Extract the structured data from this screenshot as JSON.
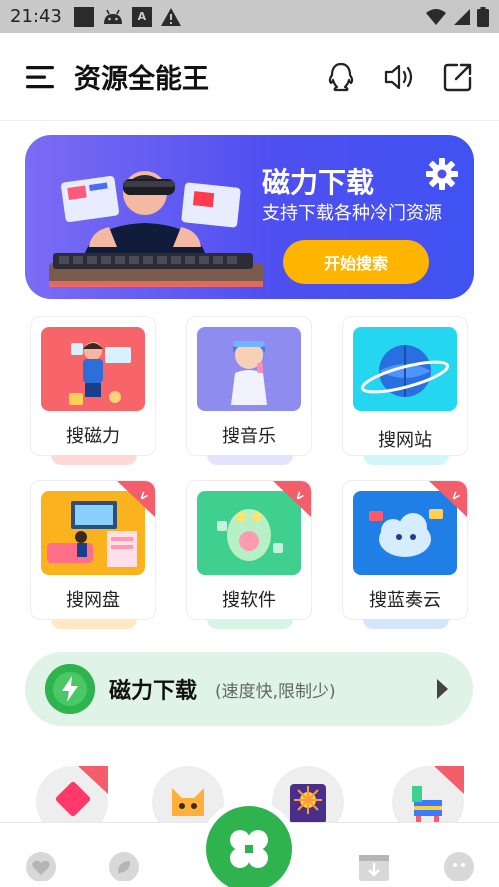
{
  "status_bar": {
    "time": "21:43"
  },
  "header": {
    "title": "资源全能王"
  },
  "banner": {
    "title": "磁力下载",
    "subtitle": "支持下载各种冷门资源",
    "button_label": "开始搜索"
  },
  "grid": [
    {
      "label": "搜磁力",
      "vip": false,
      "color": "#f7656a"
    },
    {
      "label": "搜音乐",
      "vip": false,
      "color": "#8f8cf0"
    },
    {
      "label": "搜网站",
      "vip": false,
      "color": "#25d6f0"
    },
    {
      "label": "搜网盘",
      "vip": true,
      "color": "#fbb21f"
    },
    {
      "label": "搜软件",
      "vip": true,
      "color": "#3fcf8e"
    },
    {
      "label": "搜蓝奏云",
      "vip": true,
      "color": "#1f7fe6"
    }
  ],
  "strip": {
    "title": "磁力下载",
    "description": "(速度快,限制少)",
    "accent": "#2fb34f"
  },
  "colors": {
    "accent": "#2fb34f",
    "banner": "#4f4ff0",
    "button": "#ffb400",
    "vip": "#f35e6a"
  }
}
